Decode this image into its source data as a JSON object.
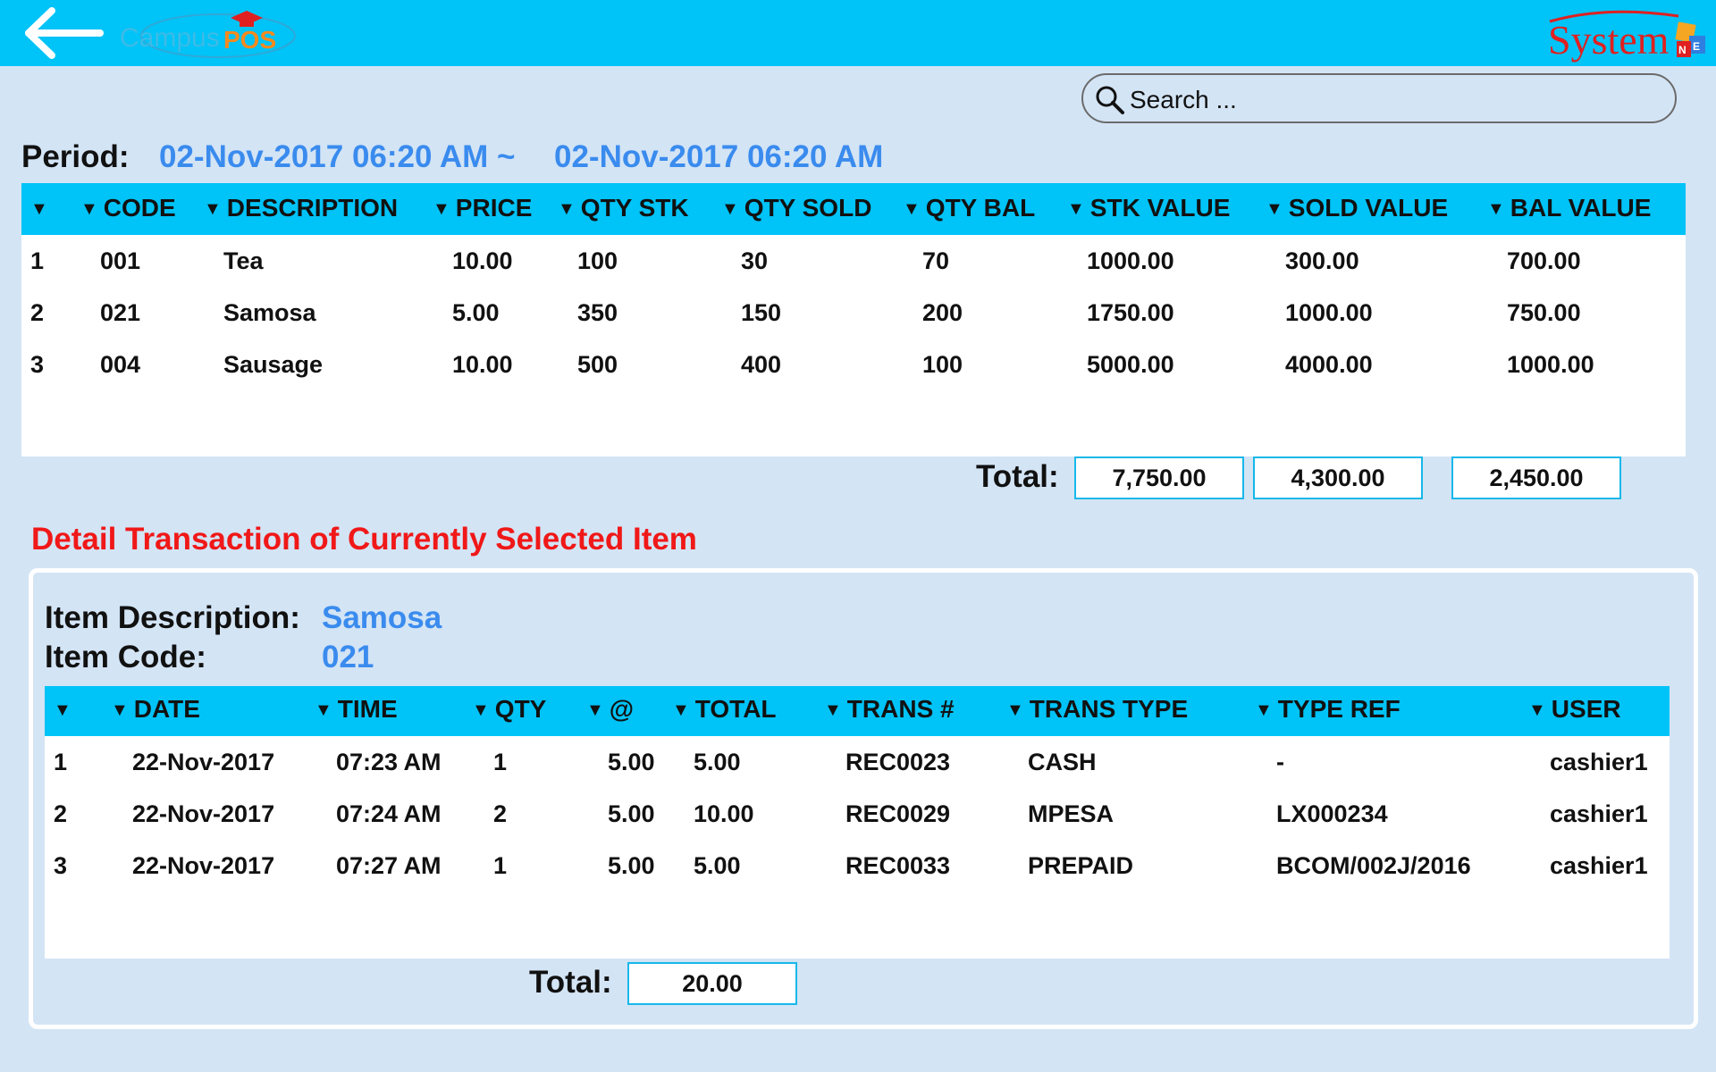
{
  "header": {
    "app_logo_text": "CampusPOS",
    "vendor_logo_text": "SystemNE"
  },
  "search": {
    "placeholder": "Search ..."
  },
  "period": {
    "label": "Period:",
    "from": "02-Nov-2017 06:20 AM ~",
    "to": "02-Nov-2017 06:20 AM"
  },
  "stock_table": {
    "columns": [
      "",
      "CODE",
      "DESCRIPTION",
      "PRICE",
      "QTY STK",
      "QTY SOLD",
      "QTY BAL",
      "STK VALUE",
      "SOLD VALUE",
      "BAL VALUE"
    ],
    "rows": [
      [
        "1",
        "001",
        "Tea",
        "10.00",
        "100",
        "30",
        "70",
        "1000.00",
        "300.00",
        "700.00"
      ],
      [
        "2",
        "021",
        "Samosa",
        "5.00",
        "350",
        "150",
        "200",
        "1750.00",
        "1000.00",
        "750.00"
      ],
      [
        "3",
        "004",
        "Sausage",
        "10.00",
        "500",
        "400",
        "100",
        "5000.00",
        "4000.00",
        "1000.00"
      ]
    ],
    "total_label": "Total:",
    "totals": [
      "7,750.00",
      "4,300.00",
      "2,450.00"
    ]
  },
  "detail": {
    "title": "Detail Transaction of Currently Selected Item",
    "item_description_label": "Item Description:",
    "item_description": "Samosa",
    "item_code_label": "Item Code:",
    "item_code": "021",
    "columns": [
      "",
      "DATE",
      "TIME",
      "QTY",
      "@",
      "TOTAL",
      "TRANS #",
      "TRANS TYPE",
      "TYPE REF",
      "USER"
    ],
    "rows": [
      [
        "1",
        "22-Nov-2017",
        "07:23 AM",
        "1",
        "5.00",
        "5.00",
        "REC0023",
        "CASH",
        "-",
        "cashier1"
      ],
      [
        "2",
        "22-Nov-2017",
        "07:24 AM",
        "2",
        "5.00",
        "10.00",
        "REC0029",
        "MPESA",
        "LX000234",
        "cashier1"
      ],
      [
        "3",
        "22-Nov-2017",
        "07:27 AM",
        "1",
        "5.00",
        "5.00",
        "REC0033",
        "PREPAID",
        "BCOM/002J/2016",
        "cashier1"
      ]
    ],
    "total_label": "Total:",
    "total": "20.00"
  },
  "colors": {
    "header_bar": "#00c3f7",
    "background": "#d3e4f5",
    "accent_blue_text": "#3a8bee",
    "detail_title_red": "#f01818"
  }
}
